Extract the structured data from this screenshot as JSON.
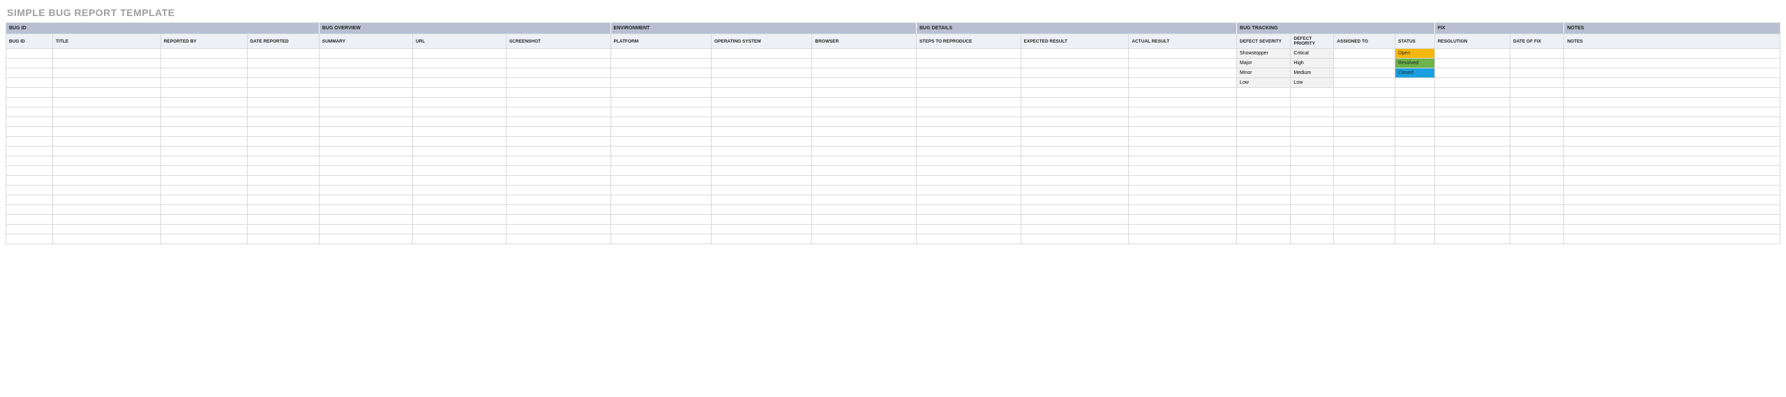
{
  "title": "SIMPLE BUG REPORT TEMPLATE",
  "groups": {
    "bug_id": "BUG ID",
    "bug_overview": "BUG OVERVIEW",
    "environment": "ENVIRONMENT",
    "bug_details": "BUG DETAILS",
    "bug_tracking": "BUG TRACKING",
    "fix": "FIX",
    "notes": "NOTES"
  },
  "columns": {
    "bug_id": "BUG ID",
    "title": "TITLE",
    "reported_by": "REPORTED BY",
    "date_reported": "DATE REPORTED",
    "summary": "SUMMARY",
    "url": "URL",
    "screenshot": "SCREENSHOT",
    "platform": "PLATFORM",
    "operating_system": "OPERATING SYSTEM",
    "browser": "BROWSER",
    "steps_to_reproduce": "STEPS TO REPRODUCE",
    "expected_result": "EXPECTED RESULT",
    "actual_result": "ACTUAL RESULT",
    "defect_severity": "DEFECT SEVERITY",
    "defect_priority": "DEFECT PRIORITY",
    "assigned_to": "ASSIGNED TO",
    "status": "STATUS",
    "resolution": "RESOLUTION",
    "date_of_fix": "DATE OF FIX",
    "notes": "NOTES"
  },
  "rows": [
    {
      "defect_severity": "Showstopper",
      "defect_priority": "Critical",
      "status": "Open"
    },
    {
      "defect_severity": "Major",
      "defect_priority": "High",
      "status": "Resolved"
    },
    {
      "defect_severity": "Minor",
      "defect_priority": "Medium",
      "status": "Closed"
    },
    {
      "defect_severity": "Low",
      "defect_priority": "Low",
      "status": ""
    },
    {},
    {},
    {},
    {},
    {},
    {},
    {},
    {},
    {},
    {},
    {},
    {},
    {},
    {},
    {},
    {}
  ],
  "status_styles": {
    "Open": "status-open",
    "Resolved": "status-resolved",
    "Closed": "status-closed"
  }
}
